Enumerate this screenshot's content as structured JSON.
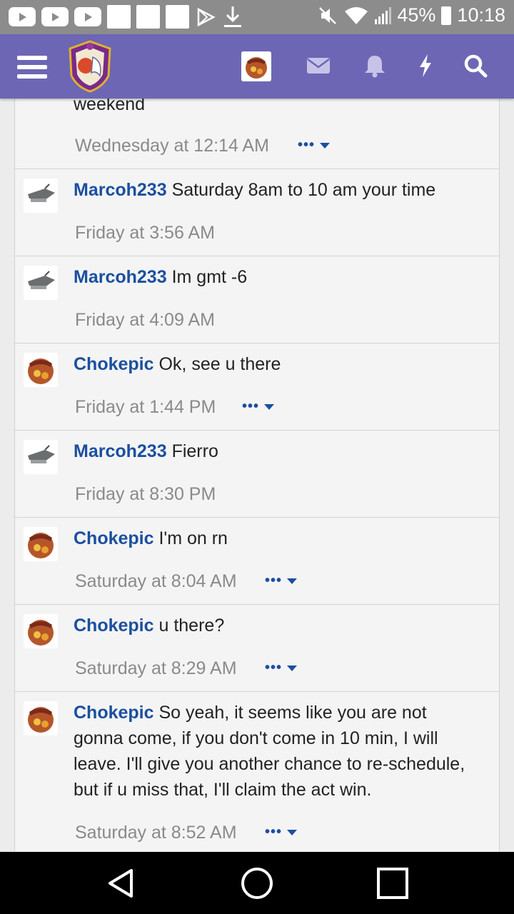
{
  "status_bar": {
    "battery": "45%",
    "time": "10:18",
    "colors": {
      "background": "#8c8c8c"
    }
  },
  "topbar": {
    "icons": [
      "menu-icon",
      "site-logo",
      "avatar",
      "mail-icon",
      "bell-icon",
      "bolt-icon",
      "search-icon"
    ],
    "colors": {
      "background": "#6c66b5"
    }
  },
  "top_partial": {
    "text": "weekend",
    "time": "Wednesday at 12:14 AM"
  },
  "messages": [
    {
      "user": "Marcoh233",
      "text": "Saturday 8am to 10 am your time",
      "time": "Friday at 3:56 AM",
      "menu": "",
      "avatar": "gray-airplane-avatar"
    },
    {
      "user": "Marcoh233",
      "text": "Im gmt -6",
      "time": "Friday at 4:09 AM",
      "menu": "",
      "avatar": "gray-airplane-avatar"
    },
    {
      "user": "Chokepic",
      "text": "Ok, see u there",
      "time": "Friday at 1:44 PM",
      "menu": "•••",
      "avatar": "chocapic-avatar"
    },
    {
      "user": "Marcoh233",
      "text": "Fierro",
      "time": "Friday at 8:30 PM",
      "menu": "",
      "avatar": "gray-airplane-avatar"
    },
    {
      "user": "Chokepic",
      "text": "I'm on rn",
      "time": "Saturday at 8:04 AM",
      "menu": "•••",
      "avatar": "chocapic-avatar"
    },
    {
      "user": "Chokepic",
      "text": "u there?",
      "time": "Saturday at 8:29 AM",
      "menu": "•••",
      "avatar": "chocapic-avatar"
    },
    {
      "user": "Chokepic",
      "text": "So yeah, it seems like you are not gonna come, if you don't come in 10 min, I will leave. I'll give you another chance to re-schedule, but if u miss that, I'll claim the act win.",
      "time": "Saturday at 8:52 AM",
      "menu": "•••",
      "avatar": "chocapic-avatar"
    }
  ],
  "colors": {
    "username": "#1b4fa0",
    "meta": "#8a8a8a",
    "card": "#f4f4f4"
  },
  "nav_bar": {
    "icons": [
      "back-icon",
      "home-icon",
      "recents-icon"
    ]
  }
}
